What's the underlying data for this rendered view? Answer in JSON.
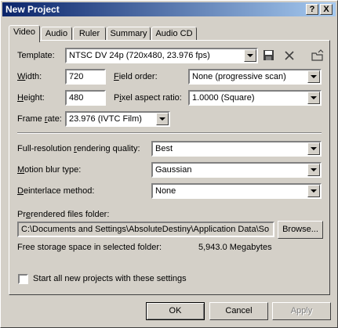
{
  "window": {
    "title": "New Project",
    "help_glyph": "?",
    "close_glyph": "X"
  },
  "tabs": [
    {
      "label": "Video",
      "active": true
    },
    {
      "label": "Audio",
      "active": false
    },
    {
      "label": "Ruler",
      "active": false
    },
    {
      "label": "Summary",
      "active": false
    },
    {
      "label": "Audio CD",
      "active": false
    }
  ],
  "video": {
    "template_label": "Template:",
    "template_value": "NTSC DV 24p (720x480, 23.976 fps)",
    "width_label": "Width:",
    "width_value": "720",
    "height_label": "Height:",
    "height_value": "480",
    "field_order_label": "Field order:",
    "field_order_value": "None (progressive scan)",
    "pixel_aspect_label": "Pixel aspect ratio:",
    "pixel_aspect_value": "1.0000 (Square)",
    "frame_rate_label": "Frame rate:",
    "frame_rate_value": "23.976 (IVTC Film)",
    "render_quality_label": "Full-resolution rendering quality:",
    "render_quality_value": "Best",
    "motion_blur_label": "Motion blur type:",
    "motion_blur_value": "Gaussian",
    "deinterlace_label": "Deinterlace method:",
    "deinterlace_value": "None",
    "prerendered_label": "Prerendered files folder:",
    "prerendered_path": "C:\\Documents and Settings\\AbsoluteDestiny\\Application Data\\So",
    "browse_label": "Browse...",
    "free_space_label": "Free storage space in selected folder:",
    "free_space_value": "5,943.0 Megabytes",
    "start_all_label": "Start all new projects with these settings",
    "start_all_checked": false
  },
  "buttons": {
    "ok": "OK",
    "cancel": "Cancel",
    "apply": "Apply"
  },
  "icons": [
    "save-template-icon",
    "delete-template-icon",
    "open-folder-icon"
  ]
}
